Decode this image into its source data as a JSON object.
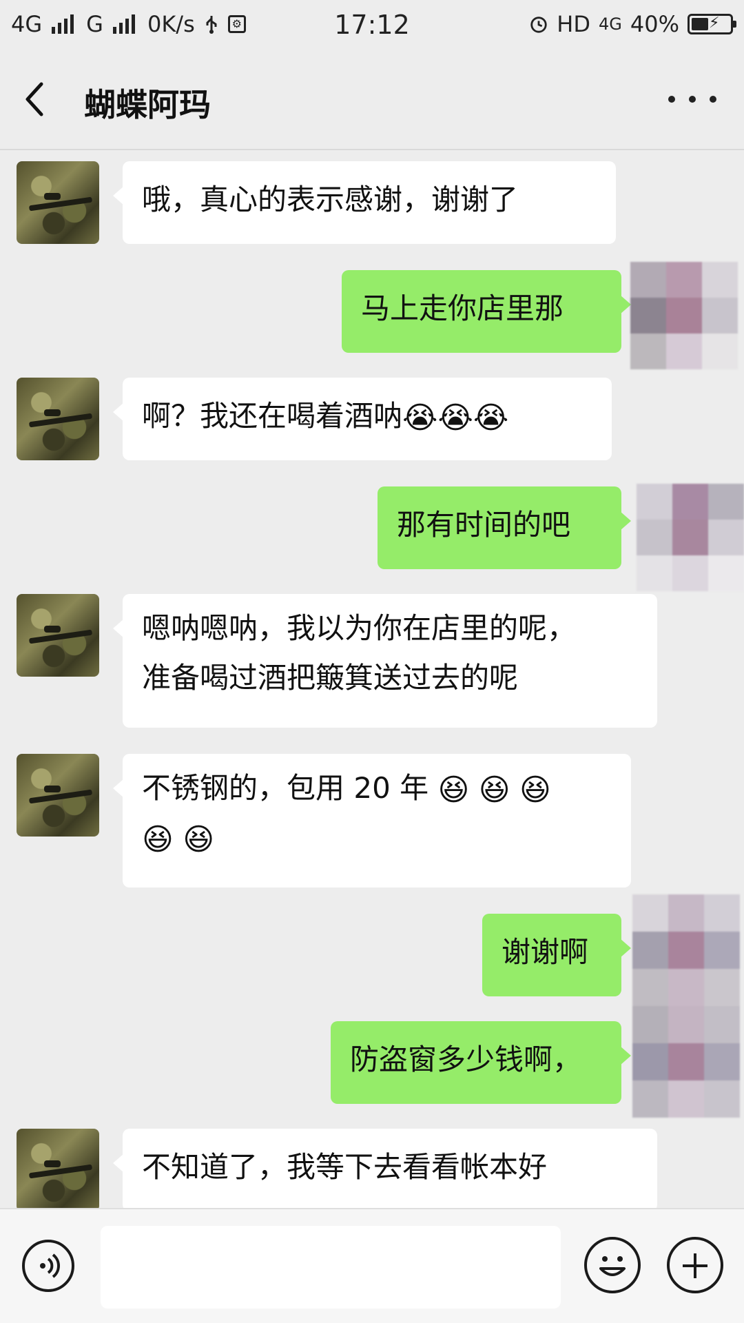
{
  "status_bar": {
    "network_1": "4G",
    "network_2": "G",
    "speed": "0K/s",
    "time": "17:12",
    "hd_label": "HD",
    "network_3": "4G",
    "battery": "40%"
  },
  "header": {
    "title": "蝴蝶阿玛",
    "icons": {
      "back": "chevron-left-icon",
      "more": "more-dots-icon"
    }
  },
  "messages": [
    {
      "side": "left",
      "text": "哦，真心的表示感谢，谢谢了"
    },
    {
      "side": "right",
      "text": "马上走你店里那"
    },
    {
      "side": "left",
      "text": "啊？我还在喝着酒呐",
      "emojis": [
        "😭",
        "😭",
        "😭"
      ]
    },
    {
      "side": "right",
      "text": "那有时间的吧"
    },
    {
      "side": "left",
      "lines": [
        "嗯呐嗯呐，我以为你在店里的呢，",
        "准备喝过酒把簸箕送过去的呢"
      ]
    },
    {
      "side": "left",
      "text": "不锈钢的，包用 20 年",
      "emojis": [
        "😆",
        "😆",
        "😆",
        "😆",
        "😆"
      ]
    },
    {
      "side": "right",
      "text": "谢谢啊"
    },
    {
      "side": "right",
      "text": "防盗窗多少钱啊，"
    },
    {
      "side": "left",
      "text": "不知道了，我等下去看看帐本好"
    }
  ],
  "input_bar": {
    "placeholder": "",
    "icons": {
      "voice": "voice-icon",
      "emoji": "emoji-icon",
      "plus": "plus-icon"
    }
  },
  "colors": {
    "background": "#ededed",
    "bubble_left": "#ffffff",
    "bubble_right": "#95ec69"
  }
}
